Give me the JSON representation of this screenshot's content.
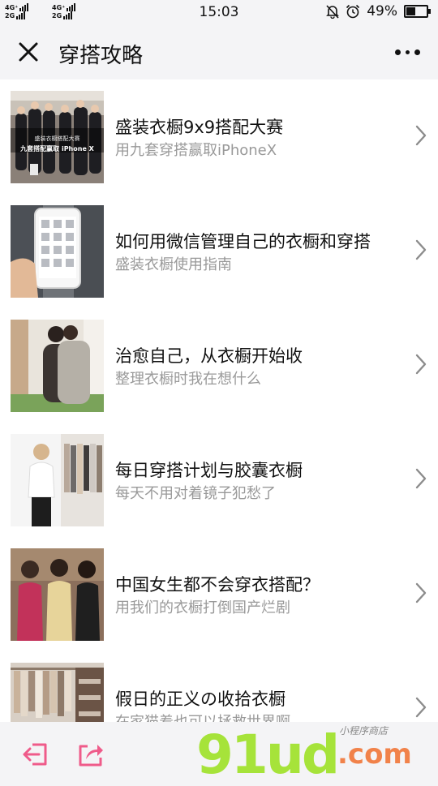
{
  "status": {
    "net1": "4G⁺",
    "net2": "4G⁺",
    "net3": "2G",
    "net4": "2G",
    "time": "15:03",
    "battery": "49%",
    "battery_level": 0.49
  },
  "nav": {
    "title": "穿搭攻略"
  },
  "articles": [
    {
      "title": "盛装衣橱9x9搭配大赛",
      "subtitle": "用九套穿搭赢取iPhoneX",
      "thumb_caption_1": "盛装衣橱搭配大赛",
      "thumb_caption_2": "九套搭配赢取 iPhone X"
    },
    {
      "title": "如何用微信管理自己的衣橱和穿搭",
      "subtitle": "盛装衣橱使用指南"
    },
    {
      "title": "治愈自己，从衣橱开始收",
      "subtitle": "整理衣橱时我在想什么"
    },
    {
      "title": "每日穿搭计划与胶囊衣橱",
      "subtitle": "每天不用对着镜子犯愁了"
    },
    {
      "title": "中国女生都不会穿衣搭配？",
      "subtitle": "用我们的衣橱打倒国产烂剧"
    },
    {
      "title": "假日的正义の收拾衣橱",
      "subtitle": "在家猫着也可以拯救世界啊"
    }
  ],
  "watermark": {
    "main": "91ud",
    "suffix": ".com",
    "tag": "小程序商店"
  },
  "colors": {
    "accent": "#ef5b8a",
    "watermark_green": "#a6e33a",
    "watermark_orange": "#f1824a"
  },
  "icons": {
    "close": "close-icon",
    "more": "more-icon",
    "chevron": "chevron-right-icon",
    "exit": "exit-icon",
    "share": "share-icon"
  }
}
